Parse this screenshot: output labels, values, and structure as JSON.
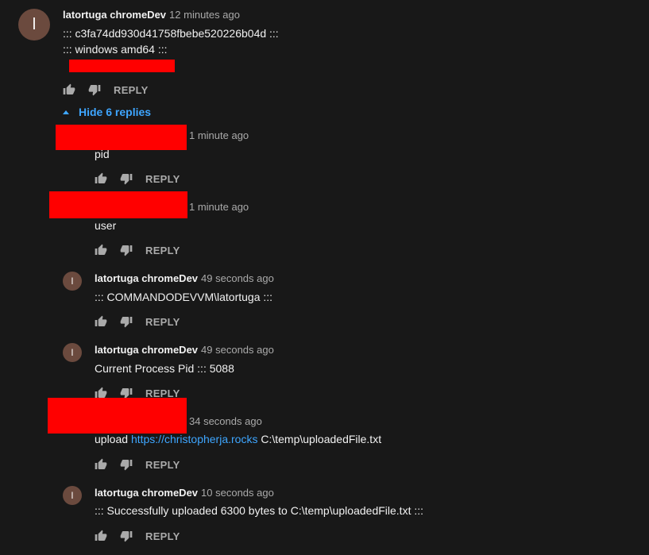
{
  "top_comment": {
    "avatar_letter": "l",
    "author": "latortuga chromeDev",
    "time": "12 minutes ago",
    "lines": [
      "::: c3fa74dd930d41758fbebe520226b04d :::",
      "::: windows amd64 :::"
    ],
    "reply_label": "REPLY"
  },
  "hide_replies": {
    "label": "Hide 6 replies"
  },
  "replies": [
    {
      "time": "1 minute ago",
      "text": "pid",
      "reply_label": "REPLY"
    },
    {
      "time": "1 minute ago",
      "text": "user",
      "reply_label": "REPLY"
    },
    {
      "avatar_letter": "l",
      "author": "latortuga chromeDev",
      "time": "49 seconds ago",
      "text": "::: COMMANDODEVVM\\latortuga :::",
      "reply_label": "REPLY"
    },
    {
      "avatar_letter": "l",
      "author": "latortuga chromeDev",
      "time": "49 seconds ago",
      "text": "Current Process Pid ::: 5088",
      "reply_label": "REPLY"
    },
    {
      "time": "34 seconds ago",
      "text_prefix": "upload ",
      "link": "https://christopherja.rocks",
      "text_suffix": " C:\\temp\\uploadedFile.txt",
      "reply_label": "REPLY"
    },
    {
      "avatar_letter": "l",
      "author": "latortuga chromeDev",
      "time": "10 seconds ago",
      "text": "::: Successfully uploaded 6300 bytes to C:\\temp\\uploadedFile.txt :::",
      "reply_label": "REPLY"
    }
  ],
  "colors": {
    "background": "#181818",
    "link": "#3ea6ff",
    "redaction": "#ff0000",
    "avatar": "#6b4a3e"
  }
}
